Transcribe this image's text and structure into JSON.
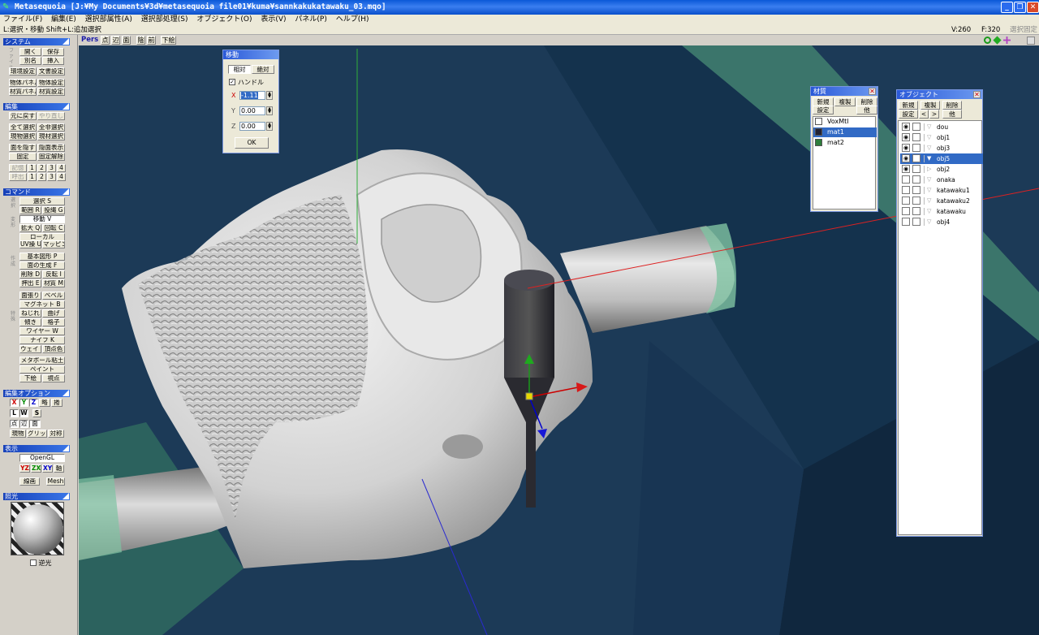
{
  "window": {
    "title": "Metasequoia [J:¥My Documents¥3d¥metasequoia file01¥kuma¥sannkakukatawaku_03.mqo]",
    "min_label": "_",
    "max_label": "❐",
    "close_label": "✕"
  },
  "menu": [
    "ファイル(F)",
    "編集(E)",
    "選択部属性(A)",
    "選択部処理(S)",
    "オブジェクト(O)",
    "表示(V)",
    "パネル(P)",
    "ヘルプ(H)"
  ],
  "status": {
    "hint": "L:選択・移動  Shift+L:追加選択",
    "vertex_count": "V:260",
    "face_count": "F:320",
    "fixed": "選択固定"
  },
  "left": {
    "system": {
      "title": "システム",
      "side_label": "ファイル",
      "open": "開く",
      "save": "保存",
      "save_as": "別名",
      "insert": "挿入",
      "env": "環境設定",
      "doc": "文書設定",
      "obj_panel": "物体パネル",
      "obj_setting": "物体設定",
      "mat_panel": "材質パネル",
      "mat_setting": "材質設定"
    },
    "edit": {
      "title": "編集",
      "undo": "元に戻す",
      "redo": "やり直し",
      "select_all": "全て選択",
      "deselect_all": "全非選択",
      "select_obj": "現物選択",
      "select_mat": "現材選択",
      "hide_face": "面を隠す",
      "show_hidden": "隠面表示",
      "fix": "固定",
      "unfix": "固定解除",
      "memory": "記憶",
      "recall": "呼出",
      "slots": [
        "1",
        "2",
        "3",
        "4"
      ]
    },
    "command": {
      "title": "コマンド",
      "select": "選択 S",
      "range": "範囲 R",
      "lasso": "投縄 G",
      "move": "移動 V",
      "scale": "拡大 Q",
      "rotate": "回転 C",
      "local": "ローカル",
      "uv": "UV操 U",
      "mapping": "マッピング",
      "basic": "基本図形 P",
      "face_gen": "面の生成 F",
      "delete": "削除 D",
      "flip": "反転 I",
      "extrude": "押出 E",
      "material": "材質 M",
      "face_cut": "面張り",
      "bevel": "ベベル",
      "magnet": "マグネット B",
      "twist": "ねじれ",
      "bend": "曲げ",
      "slope": "傾き",
      "lattice": "格子",
      "wire": "ワイヤー W",
      "knife": "ナイフ K",
      "weight": "ウェイト",
      "vcolor": "頂点色",
      "metaball": "メタボール粘土",
      "paint": "ペイント",
      "underlay": "下絵",
      "viewpoint": "視点",
      "side_labels": [
        "選択",
        "変形",
        "作成",
        "特殊"
      ]
    },
    "edit_option": {
      "title": "編集オプション",
      "x": "X",
      "y": "Y",
      "z": "Z",
      "abbr": "略",
      "ang": "捲",
      "l": "L",
      "w": "W",
      "s": "S",
      "point": "点",
      "edge": "辺",
      "face": "面",
      "current": "現物",
      "grid": "グリッド",
      "sym": "対称"
    },
    "display": {
      "title": "表示",
      "opengl": "OpenGL",
      "yz": "YZ",
      "zx": "ZX",
      "xy": "XY",
      "axis": "軸",
      "wire": "線画",
      "mesh": "Mesh"
    },
    "light": {
      "title": "照光",
      "backlight": "逆光"
    }
  },
  "viewtool": {
    "pers": "Pers",
    "buttons": [
      "点",
      "辺",
      "面",
      "陰",
      "前",
      "下絵"
    ]
  },
  "move_dialog": {
    "title": "移動",
    "relative": "相対",
    "absolute": "絶対",
    "handle": "ハンドル",
    "handle_checked": true,
    "x_label": "X",
    "x_value": "-1.11",
    "y_label": "Y",
    "y_value": "0.00",
    "z_label": "Z",
    "z_value": "0.00",
    "ok": "OK"
  },
  "material_panel": {
    "title": "材質",
    "new": "新規",
    "copy": "複製",
    "delete": "削除",
    "settings": "設定",
    "other": "他",
    "items": [
      {
        "name": "VoxMtl",
        "color": "#ffffff"
      },
      {
        "name": "mat1",
        "color": "#222233"
      },
      {
        "name": "mat2",
        "color": "#2e7d3c"
      }
    ],
    "selected": "mat1"
  },
  "object_panel": {
    "title": "オブジェクト",
    "new": "新規",
    "copy": "複製",
    "delete": "削除",
    "settings": "設定",
    "up": "<",
    "down": ">",
    "other": "他",
    "items": [
      {
        "name": "dou",
        "visible": true
      },
      {
        "name": "obj1",
        "visible": true
      },
      {
        "name": "obj3",
        "visible": true
      },
      {
        "name": "obj5",
        "visible": true
      },
      {
        "name": "obj2",
        "visible": true
      },
      {
        "name": "onaka",
        "visible": false
      },
      {
        "name": "katawaku1",
        "visible": false
      },
      {
        "name": "katawaku2",
        "visible": false
      },
      {
        "name": "katawaku",
        "visible": false
      },
      {
        "name": "obj4",
        "visible": false
      }
    ],
    "selected": "obj5"
  },
  "colors": {
    "viewport_bg": "#1c3a57",
    "accent": "#316ac5",
    "title_blue": "#0a58d8"
  }
}
